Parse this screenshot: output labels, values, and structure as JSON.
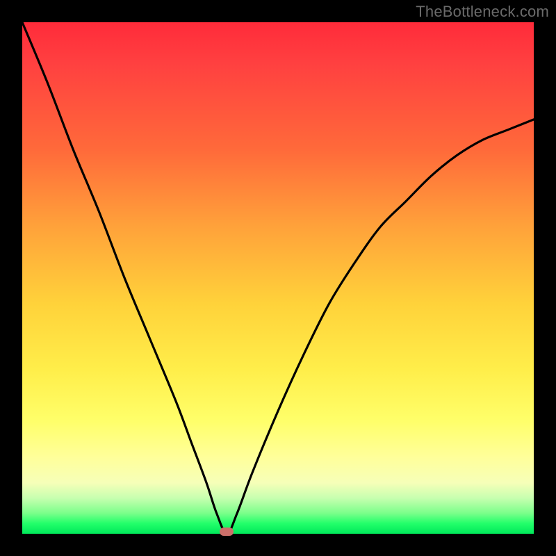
{
  "watermark": "TheBottleneck.com",
  "colors": {
    "frame": "#000000",
    "curve": "#000000",
    "marker": "#cc6f6a",
    "gradient_top": "#ff2b3a",
    "gradient_bottom": "#00e85a"
  },
  "chart_data": {
    "type": "line",
    "title": "",
    "xlabel": "",
    "ylabel": "",
    "xlim": [
      0,
      100
    ],
    "ylim": [
      0,
      100
    ],
    "grid": false,
    "legend": false,
    "annotations": [
      {
        "name": "bottleneck-marker",
        "x": 40,
        "y": 0
      }
    ],
    "series": [
      {
        "name": "bottleneck-curve",
        "x": [
          0,
          5,
          10,
          15,
          20,
          25,
          30,
          33,
          36,
          38,
          40,
          42,
          45,
          50,
          55,
          60,
          65,
          70,
          75,
          80,
          85,
          90,
          95,
          100
        ],
        "values": [
          100,
          88,
          75,
          63,
          50,
          38,
          26,
          18,
          10,
          4,
          0,
          4,
          12,
          24,
          35,
          45,
          53,
          60,
          65,
          70,
          74,
          77,
          79,
          81
        ]
      }
    ]
  }
}
